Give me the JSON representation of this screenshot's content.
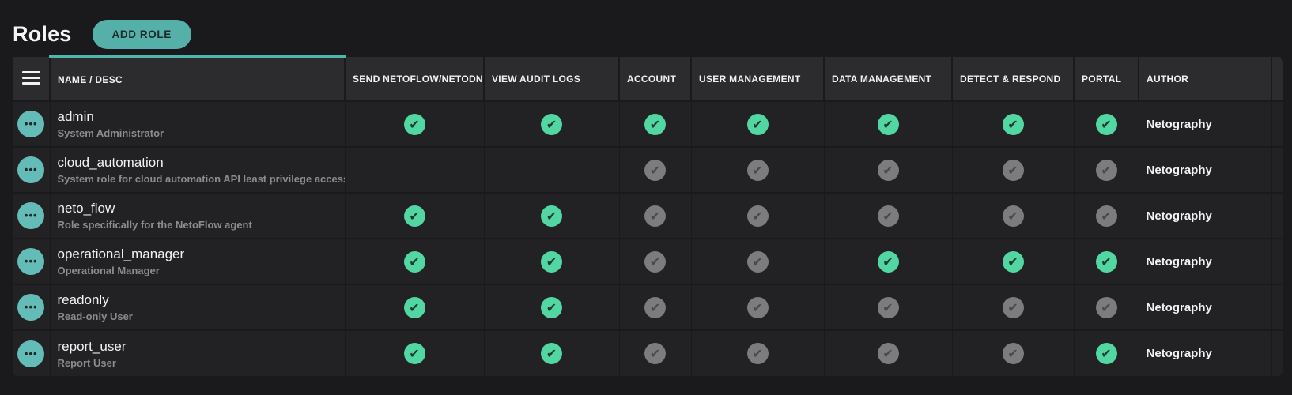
{
  "page": {
    "title": "Roles",
    "add_role_label": "ADD ROLE"
  },
  "colors": {
    "accent_teal": "#56b0aa",
    "sort_indicator": "#4fb6ae",
    "check_enabled": "#52d6a2",
    "check_disabled": "#7c7c7e",
    "background": "#1a1a1c",
    "header_bg": "#2c2c2f",
    "row_bg": "#222225"
  },
  "table": {
    "columns": {
      "name": "NAME / DESC",
      "send": "SEND NETOFLOW/NETODNS",
      "audit": "VIEW AUDIT LOGS",
      "account": "ACCOUNT",
      "user_mgmt": "USER MANAGEMENT",
      "data_mgmt": "DATA MANAGEMENT",
      "detect": "DETECT & RESPOND",
      "portal": "PORTAL",
      "author": "AUTHOR"
    },
    "row_menu_glyph": "•••",
    "rows": [
      {
        "name": "admin",
        "desc": "System Administrator",
        "permissions": [
          "on",
          "on",
          "on",
          "on",
          "on",
          "on",
          "on"
        ],
        "author": "Netography"
      },
      {
        "name": "cloud_automation",
        "desc": "System role for cloud automation API least privilege access",
        "permissions": [
          "none",
          "none",
          "off",
          "off",
          "off",
          "off",
          "off"
        ],
        "author": "Netography"
      },
      {
        "name": "neto_flow",
        "desc": "Role specifically for the NetoFlow agent",
        "permissions": [
          "on",
          "on",
          "off",
          "off",
          "off",
          "off",
          "off"
        ],
        "author": "Netography"
      },
      {
        "name": "operational_manager",
        "desc": "Operational Manager",
        "permissions": [
          "on",
          "on",
          "off",
          "off",
          "on",
          "on",
          "on"
        ],
        "author": "Netography"
      },
      {
        "name": "readonly",
        "desc": "Read-only User",
        "permissions": [
          "on",
          "on",
          "off",
          "off",
          "off",
          "off",
          "off"
        ],
        "author": "Netography"
      },
      {
        "name": "report_user",
        "desc": "Report User",
        "permissions": [
          "on",
          "on",
          "off",
          "off",
          "off",
          "off",
          "on"
        ],
        "author": "Netography"
      }
    ]
  }
}
